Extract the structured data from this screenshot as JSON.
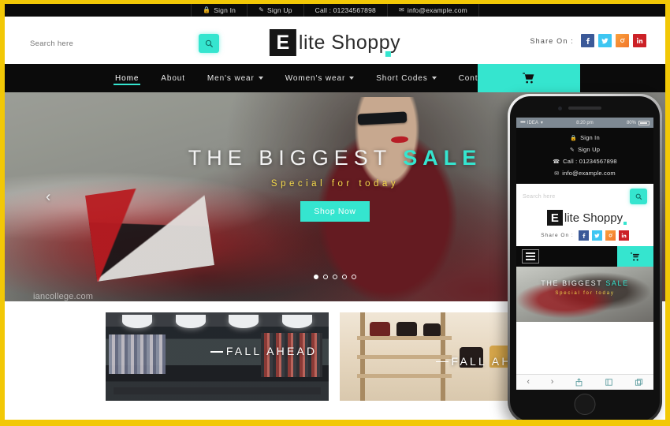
{
  "topbar": {
    "items": [
      {
        "icon": "lock-icon",
        "label": "Sign In"
      },
      {
        "icon": "signup-icon",
        "label": "Sign Up"
      },
      {
        "icon": "phone-icon",
        "label": "Call : 01234567898"
      },
      {
        "icon": "mail-icon",
        "label": "info@example.com"
      }
    ]
  },
  "header": {
    "search": {
      "placeholder": "Search here",
      "value": ""
    },
    "logo": {
      "badge": "E",
      "text": "lite Shoppy"
    },
    "share": {
      "label": "Share On :",
      "networks": [
        {
          "name": "facebook",
          "glyph": "f",
          "color": "#3b5998"
        },
        {
          "name": "twitter",
          "glyph": "t",
          "color": "#3ec6f2"
        },
        {
          "name": "instagram",
          "glyph": "i",
          "color": "#f2762b"
        },
        {
          "name": "linkedin",
          "glyph": "in",
          "color": "#cc2127"
        }
      ]
    }
  },
  "nav": {
    "items": [
      {
        "label": "Home",
        "active": true,
        "caret": false
      },
      {
        "label": "About",
        "active": false,
        "caret": false
      },
      {
        "label": "Men's wear",
        "active": false,
        "caret": true
      },
      {
        "label": "Women's wear",
        "active": false,
        "caret": true
      },
      {
        "label": "Short Codes",
        "active": false,
        "caret": true
      },
      {
        "label": "Contact",
        "active": false,
        "caret": false
      }
    ],
    "cart": {
      "icon": "cart-icon"
    }
  },
  "hero": {
    "title_main": "THE BIGGEST ",
    "title_accent": "SALE",
    "subtitle": "Special for today",
    "cta": "Shop Now",
    "dots": 5,
    "active_dot": 1,
    "prev_arrow": "‹",
    "watermark": "iancollege.com"
  },
  "tiles": [
    {
      "caption": "FALL AHEAD",
      "alt": "clothing-store-rack"
    },
    {
      "caption": "FALL AH",
      "alt": "handbag-store-shelf"
    }
  ],
  "phone": {
    "status": {
      "carrier": "IDEA",
      "signal": "••••",
      "wifi": "▾",
      "time": "8:20 pm",
      "battery": "80%"
    },
    "topbar_links": [
      {
        "icon": "lock-icon",
        "label": "Sign In"
      },
      {
        "icon": "signup-icon",
        "label": "Sign Up"
      },
      {
        "icon": "phone-icon",
        "label": "Call : 01234567898"
      },
      {
        "icon": "mail-icon",
        "label": "info@example.com"
      }
    ],
    "search": {
      "placeholder": "Search here"
    },
    "logo": {
      "badge": "E",
      "text": "lite Shoppy"
    },
    "share": {
      "label": "Share On :"
    },
    "hero": {
      "title_main": "THE BIGGEST ",
      "title_accent": "SALE",
      "subtitle": "Special for today"
    },
    "toolbar": [
      {
        "icon": "back-chevron-icon",
        "glyph": "‹"
      },
      {
        "icon": "forward-chevron-icon",
        "glyph": "›"
      },
      {
        "icon": "share-icon",
        "glyph": ""
      },
      {
        "icon": "bookmarks-icon",
        "glyph": ""
      },
      {
        "icon": "tabs-icon",
        "glyph": ""
      }
    ]
  },
  "colors": {
    "accent": "#35e5cf",
    "dark": "#0b0b0b",
    "frame": "#f2c806",
    "gold_text": "#f5d94a"
  }
}
